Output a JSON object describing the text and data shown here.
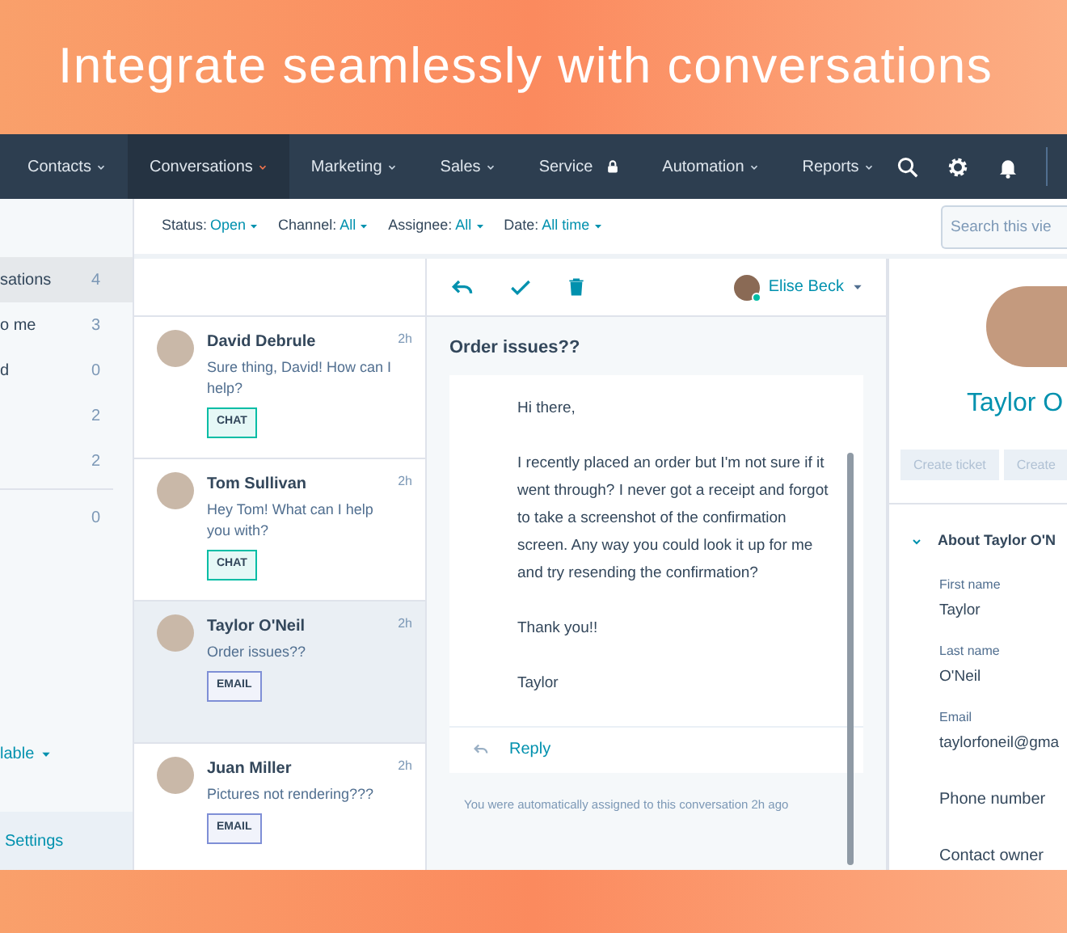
{
  "headline": "Integrate seamlessly with conversations",
  "nav": {
    "items": [
      {
        "label": "Contacts",
        "selected": false,
        "kind": "menu"
      },
      {
        "label": "Conversations",
        "selected": true,
        "kind": "menu"
      },
      {
        "label": "Marketing",
        "selected": false,
        "kind": "menu"
      },
      {
        "label": "Sales",
        "selected": false,
        "kind": "menu"
      },
      {
        "label": "Service",
        "selected": false,
        "kind": "locked"
      },
      {
        "label": "Automation",
        "selected": false,
        "kind": "menu"
      },
      {
        "label": "Reports",
        "selected": false,
        "kind": "menu"
      }
    ]
  },
  "filters": [
    {
      "label": "Status:",
      "value": "Open"
    },
    {
      "label": "Channel:",
      "value": "All"
    },
    {
      "label": "Assignee:",
      "value": "All"
    },
    {
      "label": "Date:",
      "value": "All time"
    }
  ],
  "search": {
    "placeholder": "Search this vie"
  },
  "sidebar": {
    "items": [
      {
        "label": "sations",
        "count": "4",
        "selected": true
      },
      {
        "label": "o me",
        "count": "3",
        "selected": false
      },
      {
        "label": "d",
        "count": "0",
        "selected": false
      },
      {
        "count": "2",
        "selected": false
      },
      {
        "count": "2",
        "selected": false
      },
      {
        "count": "0",
        "selected": false
      }
    ],
    "availability": "lable",
    "settings": "Settings"
  },
  "conversations": [
    {
      "name": "David Debrule",
      "time": "2h",
      "preview": "Sure thing, David! How can I help?",
      "channel": "CHAT",
      "selected": false
    },
    {
      "name": "Tom Sullivan",
      "time": "2h",
      "preview": "Hey Tom! What can I help you with?",
      "channel": "CHAT",
      "selected": false
    },
    {
      "name": "Taylor O'Neil",
      "time": "2h",
      "preview": "Order issues??",
      "channel": "EMAIL",
      "selected": true
    },
    {
      "name": "Juan Miller",
      "time": "2h",
      "preview": "Pictures not rendering???",
      "channel": "EMAIL",
      "selected": false
    }
  ],
  "thread": {
    "assignee": {
      "name": "Elise Beck",
      "online": true
    },
    "subject": "Order issues??",
    "message": [
      "Hi there,",
      "I recently placed an order but I'm not sure if it went through? I never got a receipt and forgot to take a screenshot of the confirmation screen. Any way you could look it up for me and try resending the confirmation?",
      "Thank you!!",
      "Taylor"
    ],
    "reply": "Reply",
    "note": "You were automatically assigned to this conversation 2h ago"
  },
  "contact": {
    "name": "Taylor O",
    "buttons": [
      {
        "label": "Create ticket",
        "disabled": true
      },
      {
        "label": "Create",
        "disabled": true
      }
    ],
    "section": {
      "title": "About Taylor O'N",
      "expanded": true
    },
    "fields": [
      {
        "label": "First name",
        "value": "Taylor"
      },
      {
        "label": "Last name",
        "value": "O'Neil"
      },
      {
        "label": "Email",
        "value": "taylorfoneil@gma"
      },
      {
        "label": "Phone number"
      },
      {
        "label": "Contact owner"
      }
    ]
  }
}
